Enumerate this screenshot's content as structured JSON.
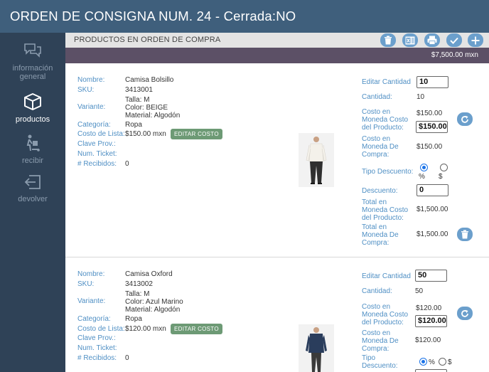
{
  "header": {
    "title": "ORDEN DE CONSIGNA NUM. 24 - Cerrada:NO"
  },
  "sidebar": {
    "items": [
      {
        "label_line1": "información",
        "label_line2": "general",
        "icon": "chat-bubbles-icon"
      },
      {
        "label": "productos",
        "icon": "box-icon"
      },
      {
        "label": "recibir",
        "icon": "hand-truck-icon"
      },
      {
        "label": "devolver",
        "icon": "return-arrow-icon"
      }
    ]
  },
  "subheader": {
    "title": "PRODUCTOS EN ORDEN DE COMPRA",
    "buttons": [
      "trash-icon",
      "excel-icon",
      "print-icon",
      "check-icon",
      "plus-icon"
    ]
  },
  "total": {
    "amount": "$7,500.00 mxn"
  },
  "labels": {
    "nombre": "Nombre:",
    "sku": "SKU:",
    "variante": "Variante:",
    "categoria": "Categoría:",
    "costo_lista": "Costo de Lista:",
    "clave_prov": "Clave Prov.:",
    "num_ticket": "Num. Ticket:",
    "recibidos": "# Recibidos:",
    "editar_cantidad": "Editar Cantidad",
    "cantidad": "Cantidad:",
    "costo_producto_1": "Costo en",
    "costo_producto_2": "Moneda Costo",
    "costo_producto_3": "del Producto:",
    "costo_compra_1": "Costo en",
    "costo_compra_2": "Moneda De",
    "costo_compra_3": "Compra:",
    "tipo_descuento": "Tipo Descuento:",
    "tipo_1": "Tipo",
    "tipo_2": "Descuento:",
    "descuento": "Descuento:",
    "total_producto_1": "Total en",
    "total_producto_2": "Moneda Costo",
    "total_producto_3": "del Producto:",
    "total_compra_1": "Total en",
    "total_compra_2": "Moneda De",
    "total_compra_3": "Compra:",
    "percent": "%",
    "dollar": "$",
    "edit_cost_button": "EDITAR COSTO"
  },
  "products": [
    {
      "nombre": "Camisa Bolsillo",
      "sku": "3413001",
      "variante_talla": "Talla: M",
      "variante_color": "Color: BEIGE",
      "variante_material": "Material: Algodón",
      "categoria": "Ropa",
      "costo_lista": "$150.00 mxn",
      "clave_prov": "",
      "num_ticket": "",
      "recibidos": "0",
      "editar_cantidad": "10",
      "cantidad": "10",
      "costo_moneda_producto": "$150.00",
      "costo_moneda_producto_input": "$150.00",
      "costo_moneda_compra": "$150.00",
      "tipo_descuento": "%",
      "descuento": "0",
      "total_moneda_producto": "$1,500.00",
      "total_moneda_compra": "$1,500.00",
      "shirt_color": "#f4f1ea",
      "pants_color": "#2f2f2f"
    },
    {
      "nombre": "Camisa Oxford",
      "sku": "3413002",
      "variante_talla": "Talla: M",
      "variante_color": "Color: Azul Marino",
      "variante_material": "Material: Algodón",
      "categoria": "Ropa",
      "costo_lista": "$120.00 mxn",
      "clave_prov": "",
      "num_ticket": "",
      "recibidos": "0",
      "editar_cantidad": "50",
      "cantidad": "50",
      "costo_moneda_producto": "$120.00",
      "costo_moneda_producto_input": "$120.00",
      "costo_moneda_compra": "$120.00",
      "tipo_descuento": "%",
      "shirt_color": "#2a3d5c",
      "pants_color": "#3a3a3a"
    }
  ]
}
